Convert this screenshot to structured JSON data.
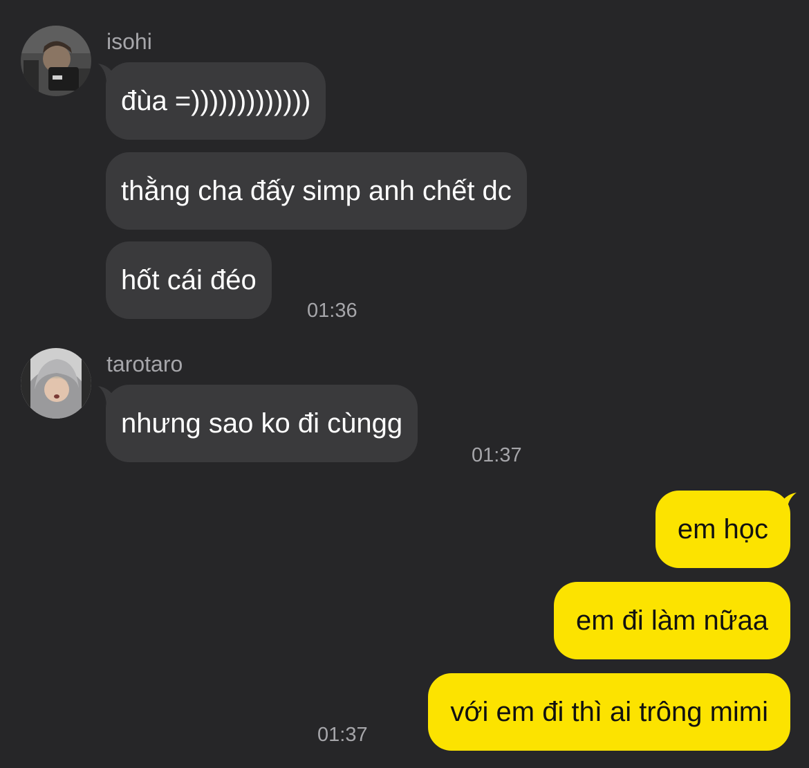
{
  "groups": [
    {
      "sender": "isohi",
      "avatar": "avatar-isohi",
      "messages": [
        "đùa =)))))))))))))",
        "thằng cha đấy simp anh chết dc",
        "hốt cái đéo"
      ],
      "time": "01:36"
    },
    {
      "sender": "tarotaro",
      "avatar": "avatar-tarotaro",
      "messages": [
        "nhưng sao ko đi cùngg"
      ],
      "time": "01:37"
    }
  ],
  "own": {
    "messages": [
      "em học",
      "em đi làm nữaa",
      "với em đi thì ai trông mimi"
    ],
    "time": "01:37"
  },
  "colors": {
    "background": "#262628",
    "incoming_bubble": "#3a3a3c",
    "outgoing_bubble": "#fce300"
  }
}
